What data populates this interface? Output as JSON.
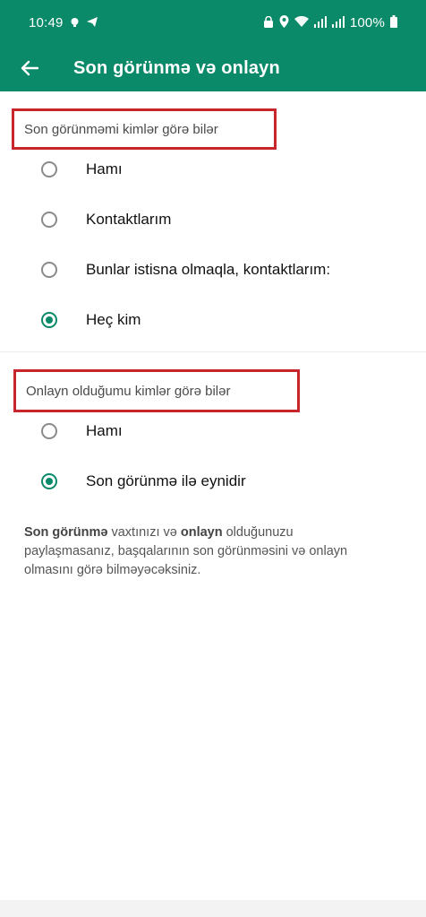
{
  "status_bar": {
    "time": "10:49",
    "battery": "100%",
    "left_icons": [
      "notification-icon",
      "telegram-icon"
    ],
    "right_icons": [
      "lock-icon",
      "location-icon",
      "wifi-icon",
      "signal-icon",
      "signal-icon",
      "battery-icon"
    ]
  },
  "app_bar": {
    "title": "Son görünmə və onlayn",
    "back_icon": "arrow-left-icon",
    "color": "#0b8a6a"
  },
  "last_seen": {
    "header": "Son görünməmi kimlər görə bilər",
    "options": [
      {
        "label": "Hamı",
        "selected": false
      },
      {
        "label": "Kontaktlarım",
        "selected": false
      },
      {
        "label": "Bunlar istisna olmaqla, kontaktlarım:",
        "selected": false
      },
      {
        "label": "Heç kim",
        "selected": true
      }
    ]
  },
  "online": {
    "header": "Onlayn olduğumu kimlər görə bilər",
    "options": [
      {
        "label": "Hamı",
        "selected": false
      },
      {
        "label": "Son görünmə ilə eynidir",
        "selected": true
      }
    ]
  },
  "note": {
    "bold1": "Son görünmə",
    "text1": " vaxtınızı və ",
    "bold2": "onlayn",
    "text2": " olduğunuzu paylaşmasanız, başqalarının son görünməsini və onlayn olmasını görə bilməyəcəksiniz."
  },
  "highlight_color": "#c8262d"
}
